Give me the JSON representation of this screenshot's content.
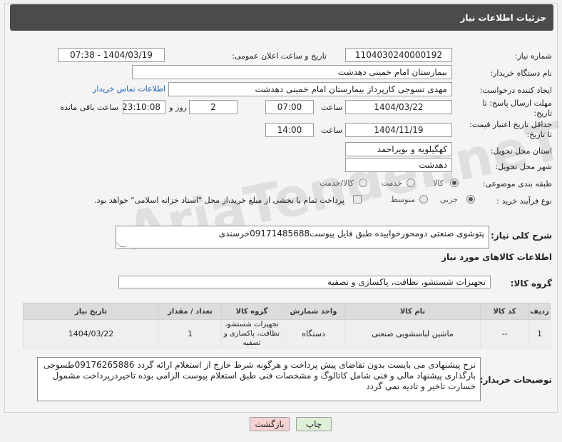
{
  "header": {
    "title": "جزئیات اطلاعات نیاز"
  },
  "labels": {
    "need_number": "شماره نیاز:",
    "announce_datetime": "تاریخ و ساعت اعلان عمومی:",
    "buyer_org": "نام دستگاه خریدار:",
    "requester": "ایجاد کننده درخواست:",
    "reply_deadline_line1": "مهلت ارسال پاسخ: تا",
    "reply_deadline_line2": "تاریخ:",
    "hour": "ساعت",
    "day_and": "روز و",
    "hours_remaining": "ساعت باقی مانده",
    "price_validity_line1": "حداقل تاریخ اعتبار قیمت:",
    "price_validity_line2": "تا تاریخ:",
    "delivery_province": "استان محل تحویل:",
    "delivery_city": "شهر محل تحویل:",
    "category": "طبقه بندی موضوعی:",
    "purchase_type": "نوع فرآیند خرید :",
    "general_desc": "شرح کلی نیاز:",
    "goods_info": "اطلاعات کالاهای مورد نیاز",
    "goods_group": "گروه کالا:",
    "buyer_notes": "توضیحات خریدار:"
  },
  "values": {
    "need_number": "1104030240000192",
    "announce_datetime": "1404/03/19 - 07:38",
    "buyer_org": "بیمارستان امام خمینی دهدشت",
    "requester": "مهدی تسوجی کارپرداز بیمارستان امام خمینی دهدشت",
    "buyer_contact_link": "اطلاعات تماس خریدار",
    "reply_date": "1404/03/22",
    "reply_time": "07:00",
    "reply_days": "2",
    "reply_remaining": "23:10:08",
    "validity_date": "1404/11/19",
    "validity_time": "14:00",
    "province": "کهگیلویه و بویراحمد",
    "city": "دهدشت",
    "general_desc": "پتوشوی صنعتی دومحورخوابیده طبق فایل پیوست09171485688خرسندی",
    "goods_group": "تجهیزات شستشو، نظافت، پاکسازی و تصفیه",
    "buyer_notes": "نرخ پیشنهادی می بایست بدون تقاضای پیش پرداخت و هرگونه شرط خارج از استعلام ارائه گردد 09176265886طسوجی بارگذاری پیشنهاد مالی و فنی شامل کاتالوگ و مشخصات فنی طبق استعلام پیوست الزامی بوده تاخیردرپرداخت مشمول خسارت تاخیر و تادیه نمی گردد"
  },
  "category_options": {
    "goods": "کالا",
    "service": "خدمت",
    "goods_service": "کالا/خدمت",
    "selected": "کالا"
  },
  "purchase_options": {
    "partial": "جزیی",
    "medium": "متوسط",
    "selected": "جزیی"
  },
  "payment_note": "پرداخت تمام یا بخشی از مبلغ خرید،از محل \"اسناد خزانه اسلامی\" خواهد بود.",
  "table": {
    "headers": [
      "ردیف",
      "کد کالا",
      "نام کالا",
      "واحد شمارش",
      "گروه کالا",
      "تعداد / مقدار",
      "تاریخ نیاز"
    ],
    "rows": [
      [
        "1",
        "--",
        "ماشین لباسشویی صنعتی",
        "دستگاه",
        "تجهیزات شستشو، نظافت، پاکسازی و تصفیه",
        "1",
        "1404/03/22"
      ]
    ]
  },
  "buttons": {
    "print": "چاپ",
    "back": "بازگشت"
  },
  "watermark": "AriaTender.neT",
  "colors": {
    "header_bg": "#4b4b4b",
    "link": "#1a5fb4",
    "back_btn": "#f7d2d2",
    "print_btn": "#dff0d8"
  }
}
